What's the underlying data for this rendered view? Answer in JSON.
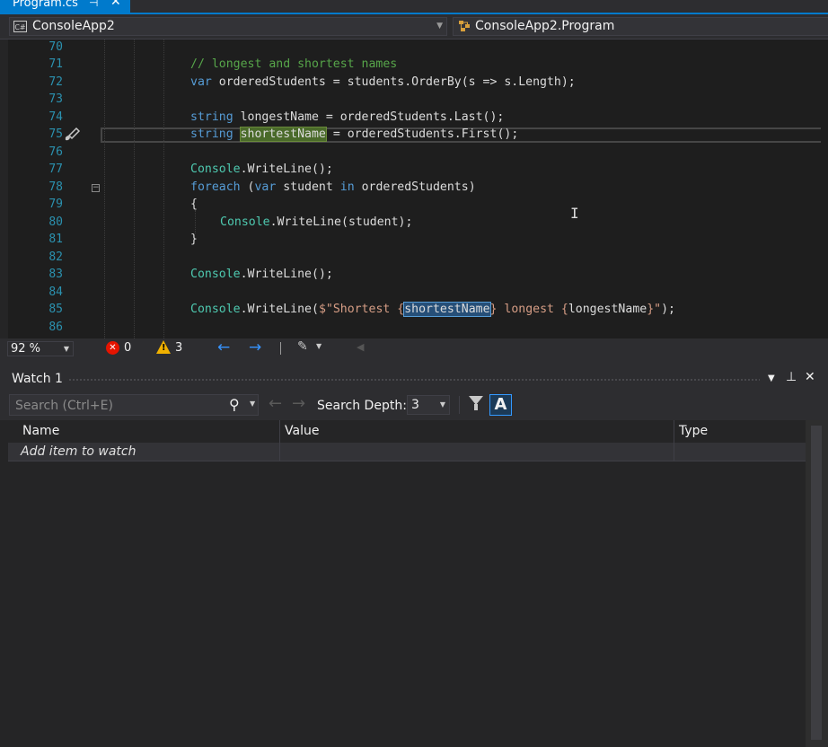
{
  "tab": {
    "title": "Program.cs",
    "pin_glyph": "⊣",
    "close_glyph": "✕"
  },
  "navbar": {
    "project": "ConsoleApp2",
    "project_icon_text": "C#",
    "class": "ConsoleApp2.Program"
  },
  "editor": {
    "line_numbers": [
      "70",
      "71",
      "72",
      "73",
      "74",
      "75",
      "76",
      "77",
      "78",
      "79",
      "80",
      "81",
      "82",
      "83",
      "84",
      "85",
      "86"
    ],
    "lines": {
      "l71": "// longest and shortest names",
      "l72a": "var",
      "l72b": " orderedStudents = students.",
      "l72c": "OrderBy",
      "l72d": "(s => s.Length);",
      "l74a": "string",
      "l74b": " longestName = orderedStudents.",
      "l74c": "Last",
      "l74d": "();",
      "l75a": "string",
      "l75b": "shortestName",
      "l75c": " = orderedStudents.",
      "l75d": "First",
      "l75e": "();",
      "l77a": "Console",
      "l77b": ".",
      "l77c": "WriteLine",
      "l77d": "();",
      "l78a": "foreach",
      "l78b": " (",
      "l78c": "var",
      "l78d": " student ",
      "l78e": "in",
      "l78f": " orderedStudents)",
      "l79": "{",
      "l80a": "Console",
      "l80b": ".",
      "l80c": "WriteLine",
      "l80d": "(student);",
      "l81": "}",
      "l83a": "Console",
      "l83b": ".",
      "l83c": "WriteLine",
      "l83d": "();",
      "l85a": "Console",
      "l85b": ".",
      "l85c": "WriteLine",
      "l85d": "(",
      "l85e": "$\"Shortest {",
      "l85f": "shortestName",
      "l85g": "} longest {",
      "l85h": "longestName",
      "l85i": "}\"",
      "l85j": ");"
    },
    "zoom": "92 %",
    "errors": "0",
    "warnings": "3"
  },
  "watch": {
    "title": "Watch 1",
    "search_placeholder": "Search (Ctrl+E)",
    "search_depth_label": "Search Depth:",
    "search_depth_value": "3",
    "case_glyph": "A",
    "columns": [
      "Name",
      "Value",
      "Type"
    ],
    "add_item": "Add item to watch"
  },
  "colors": {
    "accent": "#007acc",
    "keyword": "#569cd6",
    "comment": "#57a64a",
    "type": "#4ec9b0",
    "string": "#d69d85",
    "line_number": "#2b91af"
  }
}
